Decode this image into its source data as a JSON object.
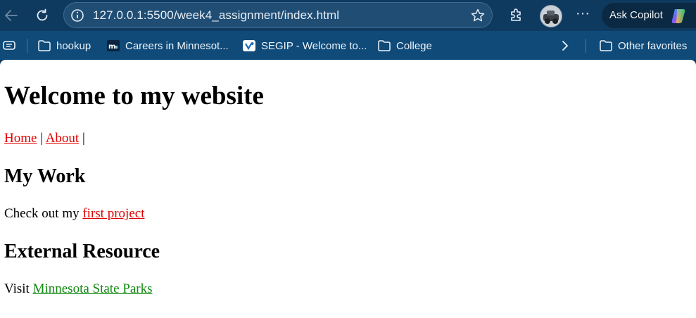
{
  "browser": {
    "address": "127.0.0.1:5500/week4_assignment/index.html",
    "copilot_label": "Ask Copilot",
    "favorites": [
      {
        "label": "hookup",
        "icon": "folder-icon"
      },
      {
        "label": "Careers in Minnesot...",
        "icon": "mn-logo-icon"
      },
      {
        "label": "SEGIP - Welcome to...",
        "icon": "segip-icon"
      },
      {
        "label": "College",
        "icon": "folder-icon"
      }
    ],
    "other_favorites": "Other favorites"
  },
  "page": {
    "title": "Welcome to my website",
    "nav": {
      "home": "Home",
      "sep1": " | ",
      "about": "About",
      "sep2": " |"
    },
    "work": {
      "heading": "My Work",
      "text": "Check out my ",
      "link": "first project"
    },
    "external": {
      "heading": "External Resource",
      "text": "Visit ",
      "link": "Minnesota State Parks"
    }
  },
  "colors": {
    "toolbar": "#0f3a60",
    "favbar": "#0f4a79",
    "link_red": "#e00000",
    "link_green": "#118a11"
  }
}
